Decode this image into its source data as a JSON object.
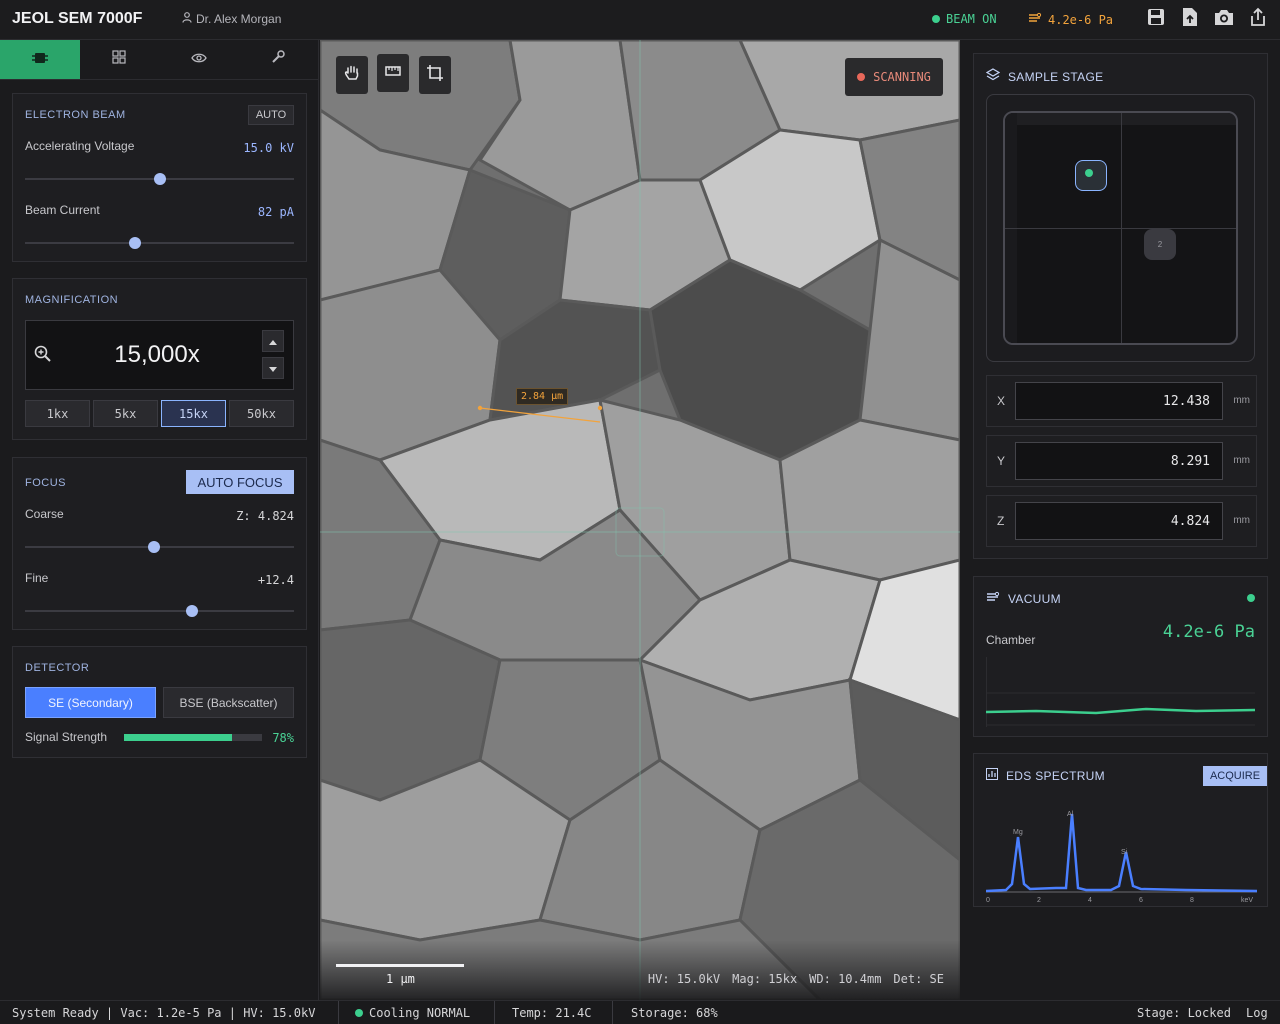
{
  "header": {
    "title": "JEOL SEM 7000F",
    "user": "Dr. Alex Morgan",
    "beam_status": "BEAM ON",
    "vacuum": "4.2e-6 Pa",
    "icons": [
      "save-icon",
      "upload-icon",
      "camera-icon",
      "share-icon"
    ]
  },
  "tabs": [
    "beam-tab-icon",
    "grid-icon",
    "eye-icon",
    "wrench-icon"
  ],
  "electron_beam": {
    "title": "ELECTRON BEAM",
    "auto_label": "AUTO",
    "voltage_label": "Accelerating Voltage",
    "voltage_value": "15.0 kV",
    "voltage_level": 0.5,
    "current_label": "Beam Current",
    "current_value": "82 pA",
    "current_level": 0.41
  },
  "magnification": {
    "title": "MAGNIFICATION",
    "value": "15,000x",
    "presets": [
      "1kx",
      "5kx",
      "15kx",
      "50kx"
    ],
    "selected_preset": "15kx"
  },
  "focus": {
    "title": "FOCUS",
    "auto_label": "AUTO FOCUS",
    "coarse_label": "Coarse",
    "coarse_value": "Z: 4.824",
    "coarse_level": 0.48,
    "fine_label": "Fine",
    "fine_value": "+12.4",
    "fine_level": 0.62
  },
  "detector": {
    "title": "DETECTOR",
    "se_label": "SE (Secondary)",
    "bse_label": "BSE (Backscatter)",
    "selected": "SE (Secondary)",
    "signal_label": "Signal Strength",
    "signal_value": "78%",
    "signal_level": 0.78
  },
  "viewer": {
    "status": "SCANNING",
    "measurement": "2.84 µm",
    "scale_label": "1 µm",
    "info_hv": "HV: 15.0kV",
    "info_mag": "Mag: 15kx",
    "info_wd": "WD: 10.4mm",
    "info_det": "Det: SE"
  },
  "stage": {
    "title": "SAMPLE STAGE",
    "marker_2": "2",
    "x_label": "X",
    "x_value": "12.438",
    "y_label": "Y",
    "y_value": "8.291",
    "z_label": "Z",
    "z_value": "4.824",
    "unit": "mm"
  },
  "vacuum_panel": {
    "title": "VACUUM",
    "chamber_label": "Chamber",
    "chamber_value": "4.2e-6 Pa"
  },
  "eds": {
    "title": "EDS SPECTRUM",
    "acquire_label": "ACQUIRE",
    "peaks": [
      "Mg",
      "Al",
      "Si"
    ],
    "ticks": [
      "0",
      "2",
      "4",
      "6",
      "8",
      "keV"
    ]
  },
  "statusbar": {
    "system": "System Ready | Vac: 1.2e-5 Pa | HV: 15.0kV",
    "cooling": "Cooling NORMAL",
    "temp": "Temp: 21.4C",
    "storage": "Storage: 68%",
    "stage": "Stage: Locked",
    "log": "Log"
  },
  "colors": {
    "accent_green": "#2aa56a",
    "accent_blue": "#4a7fff",
    "warning_orange": "#f2a33c",
    "scan_red": "#e8685a"
  }
}
